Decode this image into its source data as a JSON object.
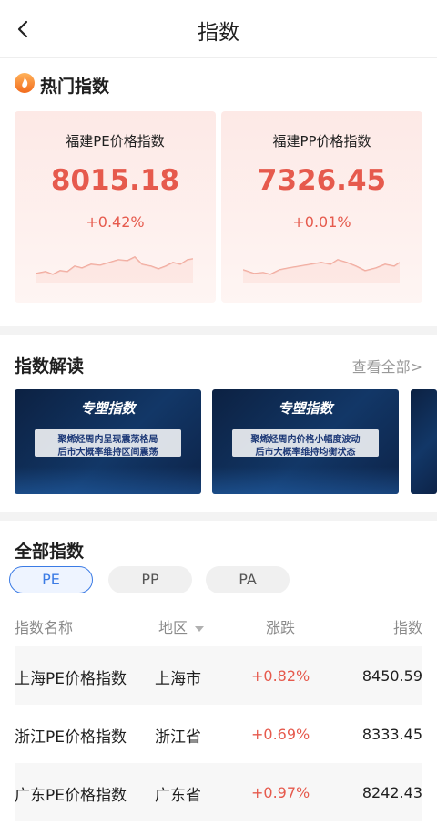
{
  "header": {
    "title": "指数"
  },
  "hot": {
    "title": "热门指数",
    "cards": [
      {
        "name": "福建PE价格指数",
        "value": "8015.18",
        "change": "+0.42%"
      },
      {
        "name": "福建PP价格指数",
        "value": "7326.45",
        "change": "+0.01%"
      }
    ]
  },
  "reading": {
    "title": "指数解读",
    "view_all": "查看全部>",
    "banners": [
      {
        "title": "专塑指数",
        "line1": "聚烯烃周内呈现震荡格局",
        "line2": "后市大概率维持区间震荡"
      },
      {
        "title": "专塑指数",
        "line1": "聚烯烃周内价格小幅度波动",
        "line2": "后市大概率维持均衡状态"
      }
    ]
  },
  "all": {
    "title": "全部指数",
    "tabs": [
      {
        "label": "PE",
        "active": true
      },
      {
        "label": "PP",
        "active": false
      },
      {
        "label": "PA",
        "active": false
      }
    ],
    "columns": {
      "name": "指数名称",
      "region": "地区",
      "change": "涨跌",
      "value": "指数"
    },
    "rows": [
      {
        "name": "上海PE价格指数",
        "region": "上海市",
        "change": "+0.82%",
        "value": "8450.59"
      },
      {
        "name": "浙江PE价格指数",
        "region": "浙江省",
        "change": "+0.69%",
        "value": "8333.45"
      },
      {
        "name": "广东PE价格指数",
        "region": "广东省",
        "change": "+0.97%",
        "value": "8242.43"
      }
    ]
  },
  "colors": {
    "rise": "#e65a4d",
    "accent": "#3b7be5",
    "muted": "#999999"
  },
  "icons": {
    "back": "chevron-left-icon",
    "fire": "fire-icon",
    "sort": "caret-down-icon"
  }
}
